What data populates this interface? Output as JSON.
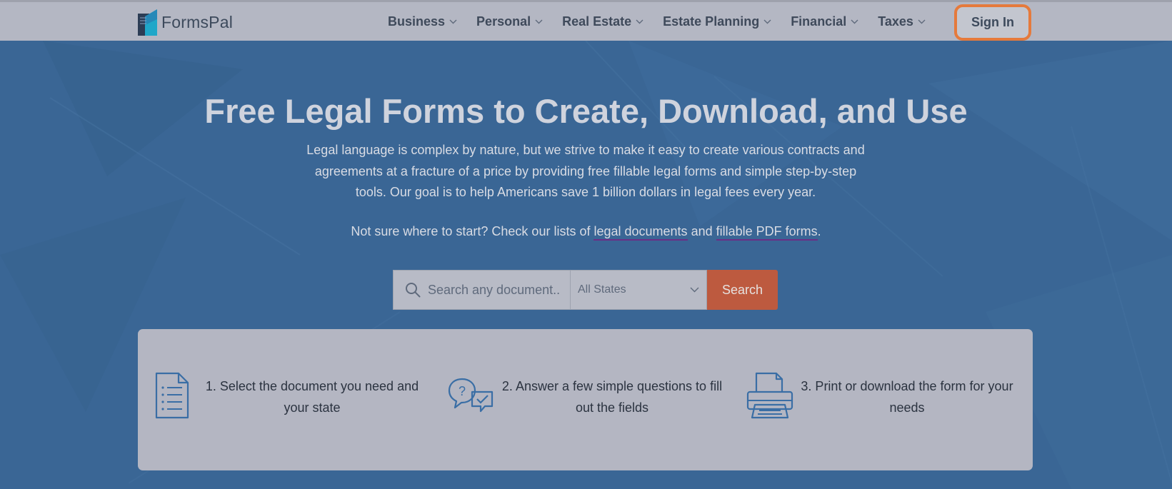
{
  "brand": {
    "name": "FormsPal"
  },
  "nav": {
    "items": [
      {
        "label": "Business"
      },
      {
        "label": "Personal"
      },
      {
        "label": "Real Estate"
      },
      {
        "label": "Estate Planning"
      },
      {
        "label": "Financial"
      },
      {
        "label": "Taxes"
      }
    ],
    "sign_in": "Sign In"
  },
  "hero": {
    "title": "Free Legal Forms to Create, Download, and Use",
    "description": "Legal language is complex by nature, but we strive to make it easy to create various contracts and agreements at a fracture of a price by providing free fillable legal forms and simple step-by-step tools. Our goal is to help Americans save 1 billion dollars in legal fees every year.",
    "links_prefix": "Not sure where to start? Check our lists of ",
    "link_legal_documents": "legal documents",
    "links_and": " and ",
    "link_pdf_forms": "fillable PDF forms",
    "links_suffix": "."
  },
  "search": {
    "placeholder": "Search any document..",
    "state_value": "All States",
    "button_label": "Search"
  },
  "steps": [
    {
      "text": "1. Select the document you need and your state",
      "icon": "document-list-icon"
    },
    {
      "text": "2. Answer a few simple questions to fill out the fields",
      "icon": "question-chat-icon"
    },
    {
      "text": "3. Print or download the form for your needs",
      "icon": "printer-icon"
    }
  ],
  "colors": {
    "hero_background": "#3a6695",
    "topbar": "#b4b7c3",
    "search_button": "#bd5a3f",
    "sign_in_border": "#e57a3c",
    "link_underline": "#6a2f86"
  }
}
